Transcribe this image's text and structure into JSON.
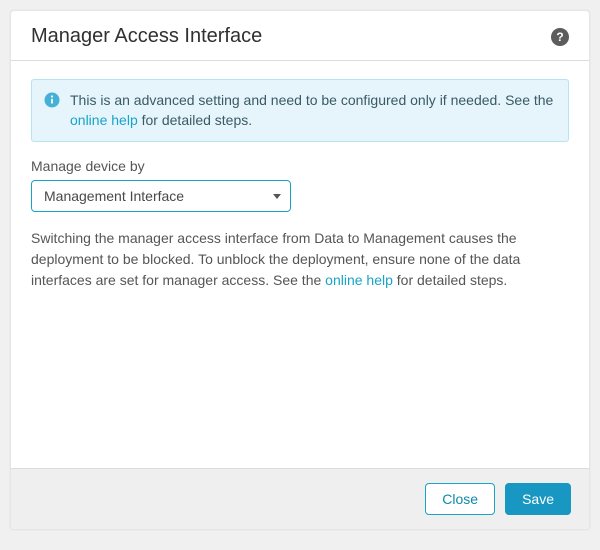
{
  "header": {
    "title": "Manager Access Interface"
  },
  "info": {
    "text_before_link": "This is an advanced setting and need to be configured only if needed. See the ",
    "link_label": "online help",
    "text_after_link": " for detailed steps."
  },
  "field": {
    "label": "Manage device by",
    "selected": "Management Interface"
  },
  "body": {
    "text_before_link": "Switching the manager access interface from Data to Management causes the deployment to be blocked. To unblock the deployment, ensure none of the data interfaces are set for manager access. See the ",
    "link_label": "online help",
    "text_after_link": " for detailed steps."
  },
  "footer": {
    "close_label": "Close",
    "save_label": "Save"
  },
  "icons": {
    "help_glyph": "?"
  }
}
